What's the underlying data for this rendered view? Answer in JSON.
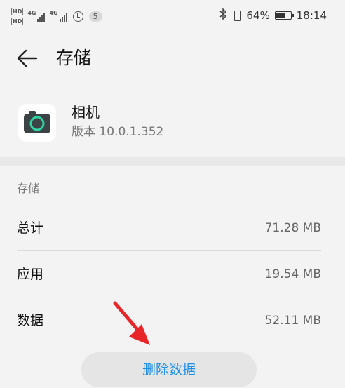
{
  "status_bar": {
    "hd_labels": [
      "HD",
      "HD"
    ],
    "network_labels": [
      "4G",
      "4G"
    ],
    "notification_count": "5",
    "battery_percent": "64%",
    "battery_level": 0.64,
    "time": "18:14",
    "icons": [
      "bluetooth-icon",
      "vibrate-icon",
      "battery-icon",
      "alarm-icon",
      "signal-icon"
    ]
  },
  "app_bar": {
    "back_icon": "arrow-left-icon",
    "title": "存储"
  },
  "app_info": {
    "icon": "camera-icon",
    "name": "相机",
    "version": "版本 10.0.1.352"
  },
  "storage": {
    "section_label": "存储",
    "rows": [
      {
        "label": "总计",
        "value": "71.28 MB"
      },
      {
        "label": "应用",
        "value": "19.54 MB"
      },
      {
        "label": "数据",
        "value": "52.11 MB"
      }
    ]
  },
  "actions": {
    "delete_label": "删除数据"
  },
  "colors": {
    "accent": "#1e8fe6",
    "annotation_arrow": "#e8262a"
  }
}
